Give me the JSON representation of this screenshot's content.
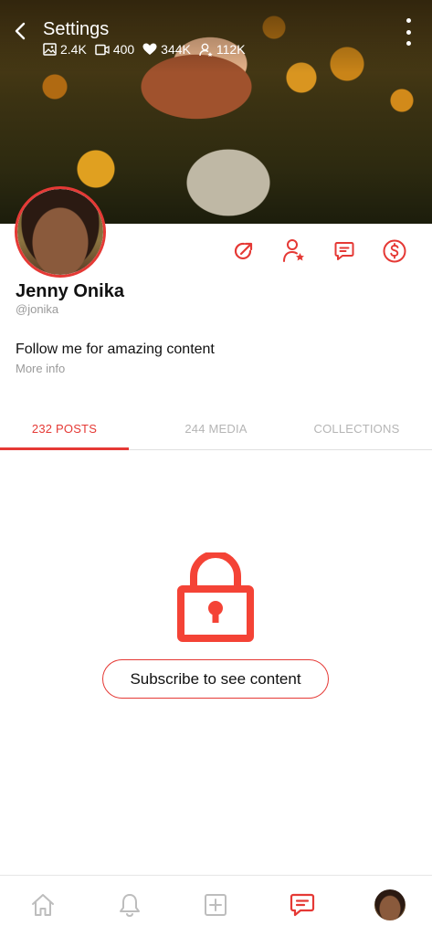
{
  "header": {
    "title": "Settings",
    "stats": {
      "photos": "2.4K",
      "videos": "400",
      "likes": "344K",
      "fans": "112K"
    }
  },
  "profile": {
    "name": "Jenny Onika",
    "handle": "@jonika",
    "bio": "Follow me for amazing content",
    "more_info": "More info"
  },
  "tabs": [
    {
      "label": "232 POSTS",
      "active": true
    },
    {
      "label": "244 MEDIA",
      "active": false
    },
    {
      "label": "COLLECTIONS",
      "active": false
    }
  ],
  "locked": {
    "subscribe_label": "Subscribe to see content"
  },
  "colors": {
    "accent": "#e53935",
    "muted": "#9a9a9a"
  },
  "icons": {
    "actions": [
      "share-icon",
      "favorite-user-icon",
      "message-icon",
      "tip-dollar-icon"
    ],
    "nav": [
      "home-icon",
      "bell-icon",
      "add-post-icon",
      "messages-icon",
      "profile-avatar"
    ]
  }
}
